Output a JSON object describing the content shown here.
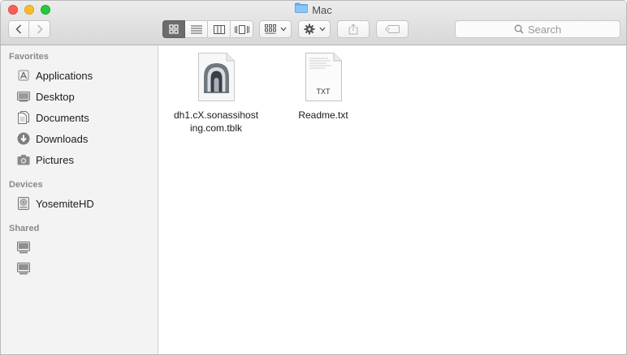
{
  "window": {
    "title": "Mac"
  },
  "toolbar": {
    "back_icon": "chevron-left-icon",
    "forward_icon": "chevron-right-icon",
    "view_modes": [
      "icon-view",
      "list-view",
      "column-view",
      "cover-flow-view"
    ],
    "active_view": "icon-view",
    "arrange_icon": "arrange-grid-icon",
    "action_icon": "gear-icon",
    "share_icon": "share-icon",
    "tag_icon": "tag-icon"
  },
  "search": {
    "placeholder": "Search"
  },
  "sidebar": {
    "favorites_header": "Favorites",
    "favorites": [
      {
        "label": "Applications",
        "icon": "applications-icon"
      },
      {
        "label": "Desktop",
        "icon": "desktop-icon"
      },
      {
        "label": "Documents",
        "icon": "documents-icon"
      },
      {
        "label": "Downloads",
        "icon": "downloads-icon"
      },
      {
        "label": "Pictures",
        "icon": "pictures-icon"
      }
    ],
    "devices_header": "Devices",
    "devices": [
      {
        "label": "YosemiteHD",
        "icon": "hard-drive-icon"
      }
    ],
    "shared_header": "Shared",
    "shared": [
      {
        "label": "",
        "icon": "computer-icon"
      },
      {
        "label": "",
        "icon": "computer-icon"
      }
    ]
  },
  "files": [
    {
      "name_line1": "dh1.cX.sonassihost",
      "name_line2": "ing.com.tblk",
      "icon": "tunnelblick-config-icon"
    },
    {
      "name_line1": "Readme.txt",
      "name_line2": "",
      "icon": "txt-document-icon",
      "badge": "TXT"
    }
  ],
  "colors": {
    "close": "#fc5f57",
    "minimize": "#fdbc2e",
    "zoom": "#28c840",
    "folder": "#6cb3f2"
  }
}
